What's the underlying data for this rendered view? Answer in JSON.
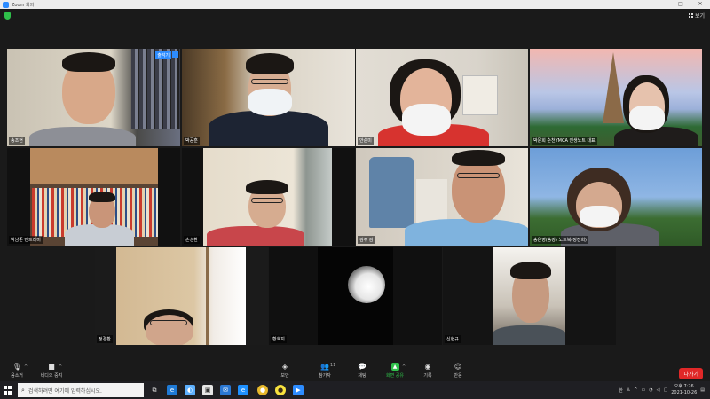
{
  "window": {
    "title": "Zoom 회의",
    "controls": [
      "–",
      "□",
      "✕"
    ]
  },
  "topbar": {
    "view_label": "보기"
  },
  "tiles": [
    {
      "name": "송조현",
      "badge": "출석기",
      "active": true
    },
    {
      "name": "박공훈"
    },
    {
      "name": "안순미"
    },
    {
      "name": "박문희 순천YMCA 인생노트 대표"
    },
    {
      "name": "박남준 맨드라미"
    },
    {
      "name": "손성환"
    },
    {
      "name": "김주 김"
    },
    {
      "name": "송은영(송강) 노트북(정진희)"
    },
    {
      "name": "정경환"
    },
    {
      "name": "황효지"
    },
    {
      "name": "신현규"
    }
  ],
  "toolbar": {
    "mute": "음소거",
    "video": "비디오 중지",
    "security": "보안",
    "participants": "참가자",
    "participant_count": "11",
    "chat": "채팅",
    "share": "화면 공유",
    "record": "기록",
    "reactions": "반응",
    "leave": "나가기"
  },
  "taskbar": {
    "search_placeholder": "검색하려면 여기에 입력하십시오.",
    "lang": "한",
    "time": "오후 7:26",
    "date": "2021-10-26"
  },
  "colors": {
    "accent": "#2d8cff",
    "active_border": "#e6e64a",
    "leave": "#e02828",
    "share": "#2fbf4a"
  }
}
